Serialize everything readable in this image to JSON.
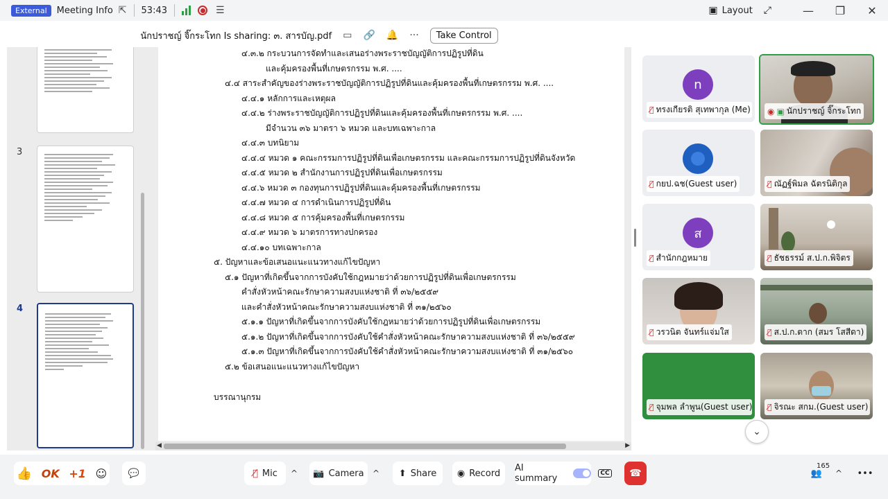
{
  "titlebar": {
    "external_badge": "External",
    "meeting_info": "Meeting Info",
    "timer": "53:43",
    "layout_label": "Layout"
  },
  "share_header": {
    "title": "นักปราชญ์ จิ๊กระโทก Is sharing: ๓. สารบัญ.pdf",
    "take_control": "Take Control"
  },
  "thumbnails": [
    {
      "number": "3"
    },
    {
      "number": "4"
    }
  ],
  "document": {
    "lines": [
      "๔.๓.๒ กระบวนการจัดทำและเสนอร่างพระราชบัญญัติการปฏิรูปที่ดิน",
      "และคุ้มครองพื้นที่เกษตรกรรม พ.ศ. ....",
      "๔.๔ สาระสำคัญของร่างพระราชบัญญัติการปฏิรูปที่ดินและคุ้มครองพื้นที่เกษตรกรรม พ.ศ. ....",
      "๔.๔.๑ หลักการและเหตุผล",
      "๔.๔.๒ ร่างพระราชบัญญัติการปฏิรูปที่ดินและคุ้มครองพื้นที่เกษตรกรรม พ.ศ. ....",
      "มีจำนวน ๓๖ มาตรา ๖ หมวด และบทเฉพาะกาล",
      "๔.๔.๓ บทนิยาม",
      "๔.๔.๔ หมวด ๑ คณะกรรมการปฏิรูปที่ดินเพื่อเกษตรกรรม และคณะกรรมการปฏิรูปที่ดินจังหวัด",
      "๔.๔.๕ หมวด ๒ สำนักงานการปฏิรูปที่ดินเพื่อเกษตรกรรม",
      "๔.๔.๖ หมวด ๓ กองทุนการปฏิรูปที่ดินและคุ้มครองพื้นที่เกษตรกรรม",
      "๔.๔.๗ หมวด ๔ การดำเนินการปฏิรูปที่ดิน",
      "๔.๔.๘ หมวด ๕ การคุ้มครองพื้นที่เกษตรกรรม",
      "๔.๔.๙ หมวด ๖ มาตรการทางปกครอง",
      "๔.๔.๑๐ บทเฉพาะกาล",
      "๕. ปัญหาและข้อเสนอแนะแนวทางแก้ไขปัญหา",
      "๕.๑ ปัญหาที่เกิดขึ้นจากการบังคับใช้กฎหมายว่าด้วยการปฏิรูปที่ดินเพื่อเกษตรกรรม",
      "คำสั่งหัวหน้าคณะรักษาความสงบแห่งชาติ ที่ ๓๖/๒๕๕๙",
      "และคำสั่งหัวหน้าคณะรักษาความสงบแห่งชาติ ที่ ๓๑/๒๕๖๐",
      "๕.๑.๑ ปัญหาที่เกิดขึ้นจากการบังคับใช้กฎหมายว่าด้วยการปฏิรูปที่ดินเพื่อเกษตรกรรม",
      "๕.๑.๒ ปัญหาที่เกิดขึ้นจากการบังคับใช้คำสั่งหัวหน้าคณะรักษาความสงบแห่งชาติ ที่ ๓๖/๒๕๕๙",
      "๕.๑.๓ ปัญหาที่เกิดขึ้นจากการบังคับใช้คำสั่งหัวหน้าคณะรักษาความสงบแห่งชาติ ที่ ๓๑/๒๕๖๐",
      "๕.๒ ข้อเสนอแนะแนวทางแก้ไขปัญหา",
      "บรรณานุกรม"
    ]
  },
  "participants": [
    {
      "name": "ทรงเกียรติ สุเทพากุล (Me)",
      "avatar_letter": "n",
      "avatar_color": "#7e3fbf"
    },
    {
      "name": "นักปราชญ์ จิ๊กระโทก",
      "avatar_letter": "",
      "avatar_color": "#6b5b4b"
    },
    {
      "name": "กยป.ฉช(Guest user)",
      "avatar_letter": "",
      "avatar_color": "#1f5fbf"
    },
    {
      "name": "ณัฏฐ์พิมล ฉัตรนิติกุล",
      "avatar_letter": "",
      "avatar_color": "#8a7a6a"
    },
    {
      "name": "สำนักกฎหมาย",
      "avatar_letter": "ส",
      "avatar_color": "#7e3fbf"
    },
    {
      "name": "ธัชธรรม์ ส.ป.ก.พิจิตร",
      "avatar_letter": "",
      "avatar_color": "#9a8a7a"
    },
    {
      "name": "วรวนิต จันทร์แจ่มใส",
      "avatar_letter": "",
      "avatar_color": "#a08070"
    },
    {
      "name": "ส.ป.ก.ตาก (สมร โสสีดา)",
      "avatar_letter": "",
      "avatar_color": "#5f7a6a"
    },
    {
      "name": "จุมพล ลำพูน(Guest user)",
      "avatar_letter": "",
      "avatar_color": "#2f8f3f"
    },
    {
      "name": "จิรณะ สกม.(Guest user)",
      "avatar_letter": "",
      "avatar_color": "#6a6a5a"
    }
  ],
  "toolbar": {
    "reaction_ok": "OK",
    "reaction_plus": "+1",
    "mic_label": "Mic",
    "camera_label": "Camera",
    "share_label": "Share",
    "record_label": "Record",
    "ai_summary_label": "AI summary",
    "participant_count": "165"
  }
}
